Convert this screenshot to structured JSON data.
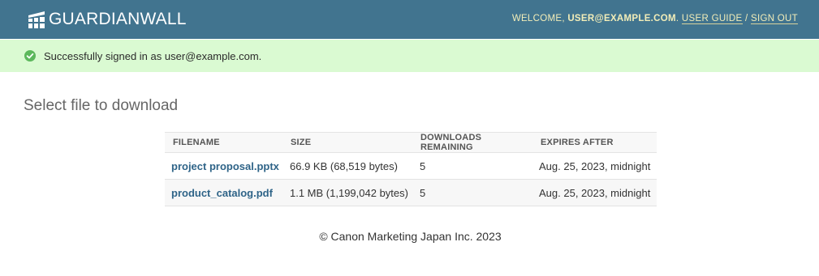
{
  "header": {
    "logo_text": "GUARDIANWALL",
    "welcome_prefix": "WELCOME,",
    "user_email": "USER@EXAMPLE.COM",
    "period": ".",
    "user_guide_label": "USER GUIDE",
    "separator": "/",
    "sign_out_label": "SIGN OUT",
    "background_color": "#41748f",
    "nav_text_color": "#f2edb8"
  },
  "alert": {
    "icon": "check-circle-icon",
    "message": "Successfully signed in as user@example.com.",
    "background_color": "#dafad2",
    "icon_color": "#5cb85c"
  },
  "main": {
    "title": "Select file to download",
    "table": {
      "columns": [
        "FILENAME",
        "SIZE",
        "DOWNLOADS REMAINING",
        "EXPIRES AFTER"
      ],
      "rows": [
        {
          "filename": "project proposal.pptx",
          "size": "66.9 KB (68,519 bytes)",
          "downloads_remaining": "5",
          "expires_after": "Aug. 25, 2023, midnight"
        },
        {
          "filename": "product_catalog.pdf",
          "size": "1.1 MB (1,199,042 bytes)",
          "downloads_remaining": "5",
          "expires_after": "Aug. 25, 2023, midnight"
        }
      ],
      "link_color": "#2f6488"
    }
  },
  "footer": {
    "copyright": "© Canon Marketing Japan Inc. 2023"
  }
}
